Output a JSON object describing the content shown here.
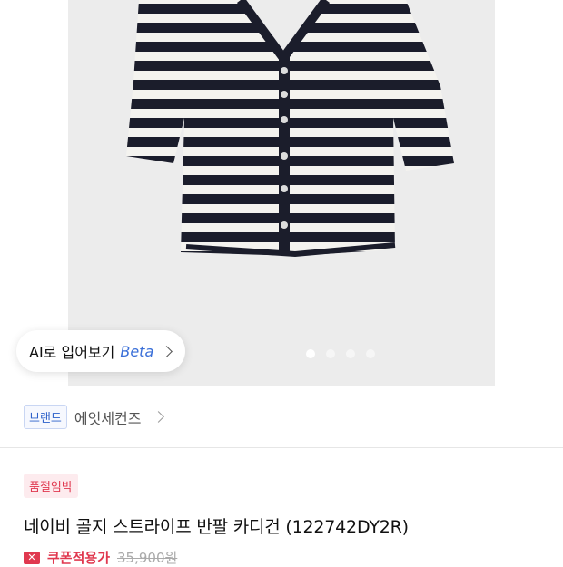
{
  "ai_tryon": {
    "label": "AI로 입어보기",
    "beta": "Beta"
  },
  "carousel": {
    "count": 4,
    "active": 0
  },
  "brand": {
    "tag": "브랜드",
    "name": "에잇세컨즈"
  },
  "product": {
    "badge": "품절임박",
    "title": "네이비 골지 스트라이프 반팔 카디건 (122742DY2R)",
    "coupon_icon": "coupon-icon",
    "coupon_label": "쿠폰적용가",
    "original_price": "35,900원"
  },
  "colors": {
    "accent": "#e0384f",
    "brand": "#2b5fc9",
    "stripe": "#1b1d2b"
  }
}
